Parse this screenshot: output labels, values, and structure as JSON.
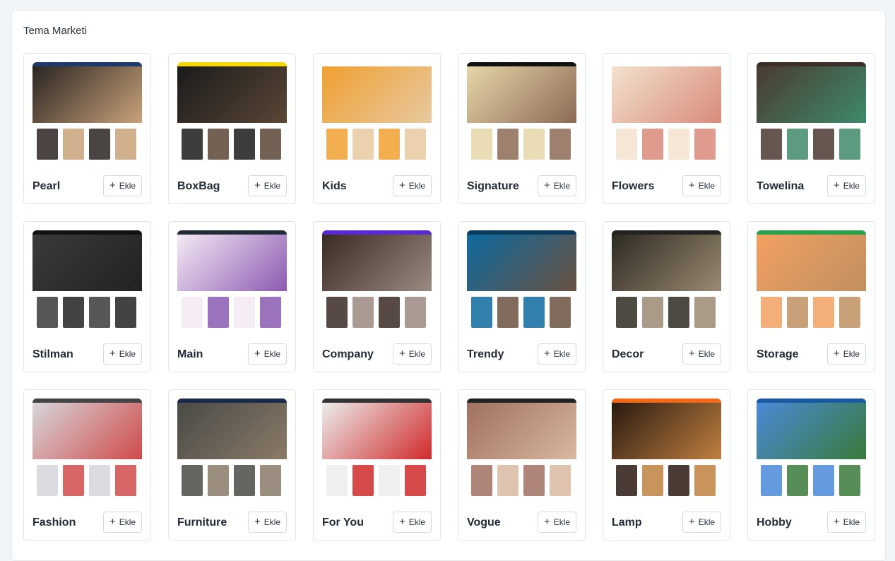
{
  "page": {
    "title": "Tema Marketi"
  },
  "themes": [
    {
      "name": "Pearl",
      "button": "Ekle",
      "hero": "#2a2522",
      "top": "#1e3a6b",
      "accent": "#c9a27a"
    },
    {
      "name": "BoxBag",
      "button": "Ekle",
      "hero": "#1b1b1b",
      "top": "#f5d800",
      "accent": "#5a4636"
    },
    {
      "name": "Kids",
      "button": "Ekle",
      "hero": "#f0a030",
      "top": "#ffffff",
      "accent": "#e7c9a0"
    },
    {
      "name": "Signature",
      "button": "Ekle",
      "hero": "#e6d6a8",
      "top": "#111111",
      "accent": "#8c6a55"
    },
    {
      "name": "Flowers",
      "button": "Ekle",
      "hero": "#f3e2cf",
      "top": "#ffffff",
      "accent": "#d98b7a"
    },
    {
      "name": "Towelina",
      "button": "Ekle",
      "hero": "#4a3a30",
      "top": "#3c2f28",
      "accent": "#3f8a6a"
    },
    {
      "name": "Stilman",
      "button": "Ekle",
      "hero": "#3a3a3a",
      "top": "#111111",
      "accent": "#222222"
    },
    {
      "name": "Main",
      "button": "Ekle",
      "hero": "#f4e9f5",
      "top": "#222a35",
      "accent": "#8a5ab0"
    },
    {
      "name": "Company",
      "button": "Ekle",
      "hero": "#3a2a24",
      "top": "#5a2ad0",
      "accent": "#9a8a80"
    },
    {
      "name": "Trendy",
      "button": "Ekle",
      "hero": "#0e6aa0",
      "top": "#0b3a5a",
      "accent": "#6a5140"
    },
    {
      "name": "Decor",
      "button": "Ekle",
      "hero": "#2e2a22",
      "top": "#222222",
      "accent": "#9a8a72"
    },
    {
      "name": "Storage",
      "button": "Ekle",
      "hero": "#f2a060",
      "top": "#2aa04a",
      "accent": "#c09060"
    },
    {
      "name": "Fashion",
      "button": "Ekle",
      "hero": "#d6d6da",
      "top": "#444444",
      "accent": "#d04a4a"
    },
    {
      "name": "Furniture",
      "button": "Ekle",
      "hero": "#4a4a46",
      "top": "#1a2a4a",
      "accent": "#8a7a68"
    },
    {
      "name": "For You",
      "button": "Ekle",
      "hero": "#ececec",
      "top": "#333333",
      "accent": "#d02a2a"
    },
    {
      "name": "Vogue",
      "button": "Ekle",
      "hero": "#a07060",
      "top": "#222222",
      "accent": "#d8b8a0"
    },
    {
      "name": "Lamp",
      "button": "Ekle",
      "hero": "#2a1a10",
      "top": "#f06a1a",
      "accent": "#c08040"
    },
    {
      "name": "Hobby",
      "button": "Ekle",
      "hero": "#4a8ad8",
      "top": "#1a5aa0",
      "accent": "#3a7a3a"
    }
  ]
}
